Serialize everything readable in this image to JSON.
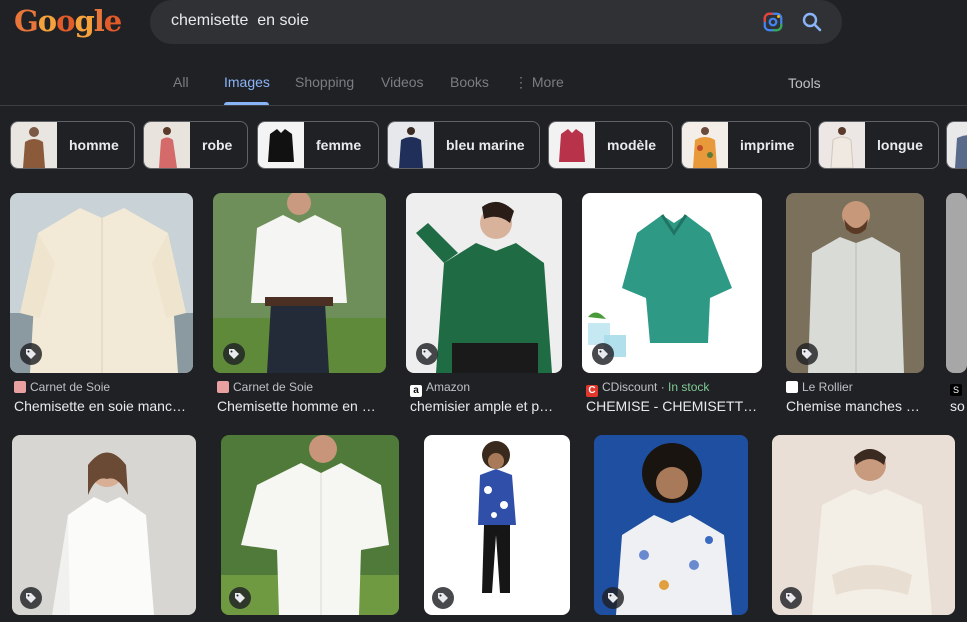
{
  "logo": {
    "letters": [
      "G",
      "o",
      "o",
      "g",
      "l",
      "e"
    ]
  },
  "search": {
    "query": "chemisette  en soie"
  },
  "icons": {
    "lens": "google-lens-icon",
    "search": "magnifier-icon",
    "tag": "price-tag-icon"
  },
  "colors": {
    "accent": "#8ab4f8",
    "background": "#202124",
    "instock": "#81c995"
  },
  "nav": {
    "tabs": [
      {
        "label": "All",
        "active": false
      },
      {
        "label": "Images",
        "active": true
      },
      {
        "label": "Shopping",
        "active": false
      },
      {
        "label": "Videos",
        "active": false
      },
      {
        "label": "Books",
        "active": false
      },
      {
        "label": "More",
        "active": false
      }
    ],
    "tools": "Tools"
  },
  "chips": [
    {
      "label": "homme"
    },
    {
      "label": "robe"
    },
    {
      "label": "femme"
    },
    {
      "label": "bleu marine"
    },
    {
      "label": "modèle"
    },
    {
      "label": "imprime"
    },
    {
      "label": "longue"
    }
  ],
  "results_row1": [
    {
      "source": "Carnet de Soie",
      "title": "Chemisette en soie manc…"
    },
    {
      "source": "Carnet de Soie",
      "title": "Chemisette homme en …"
    },
    {
      "source": "Amazon",
      "title": "chemisier ample et p…"
    },
    {
      "source": "CDiscount",
      "stock": "In stock",
      "title": "CHEMISE - CHEMISETTE …"
    },
    {
      "source": "Le Rollier",
      "title": "Chemise manches …"
    },
    {
      "source": "S",
      "title": "so"
    }
  ],
  "results_row2": [
    {
      "alt": "woman in white shirt"
    },
    {
      "alt": "man in white short-sleeve shirt"
    },
    {
      "alt": "man in blue printed shirt"
    },
    {
      "alt": "woman in printed blouse"
    },
    {
      "alt": "woman in cream blouse"
    }
  ]
}
